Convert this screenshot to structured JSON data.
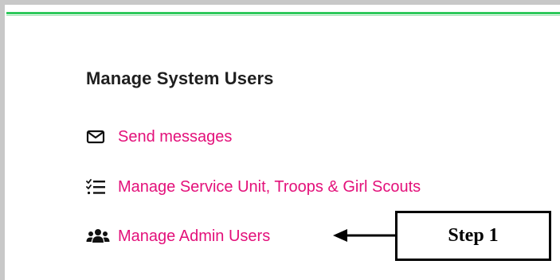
{
  "section": {
    "title": "Manage System Users",
    "items": [
      {
        "label": "Send messages",
        "icon": "envelope-icon"
      },
      {
        "label": "Manage Service Unit, Troops & Girl Scouts",
        "icon": "checklist-icon"
      },
      {
        "label": "Manage Admin Users",
        "icon": "users-icon"
      }
    ]
  },
  "annotation": {
    "label": "Step 1"
  },
  "colors": {
    "link": "#e3107a",
    "heading": "#1f1f1f",
    "accent_rule": "#2ec95c",
    "border": "#c8c8c8"
  }
}
